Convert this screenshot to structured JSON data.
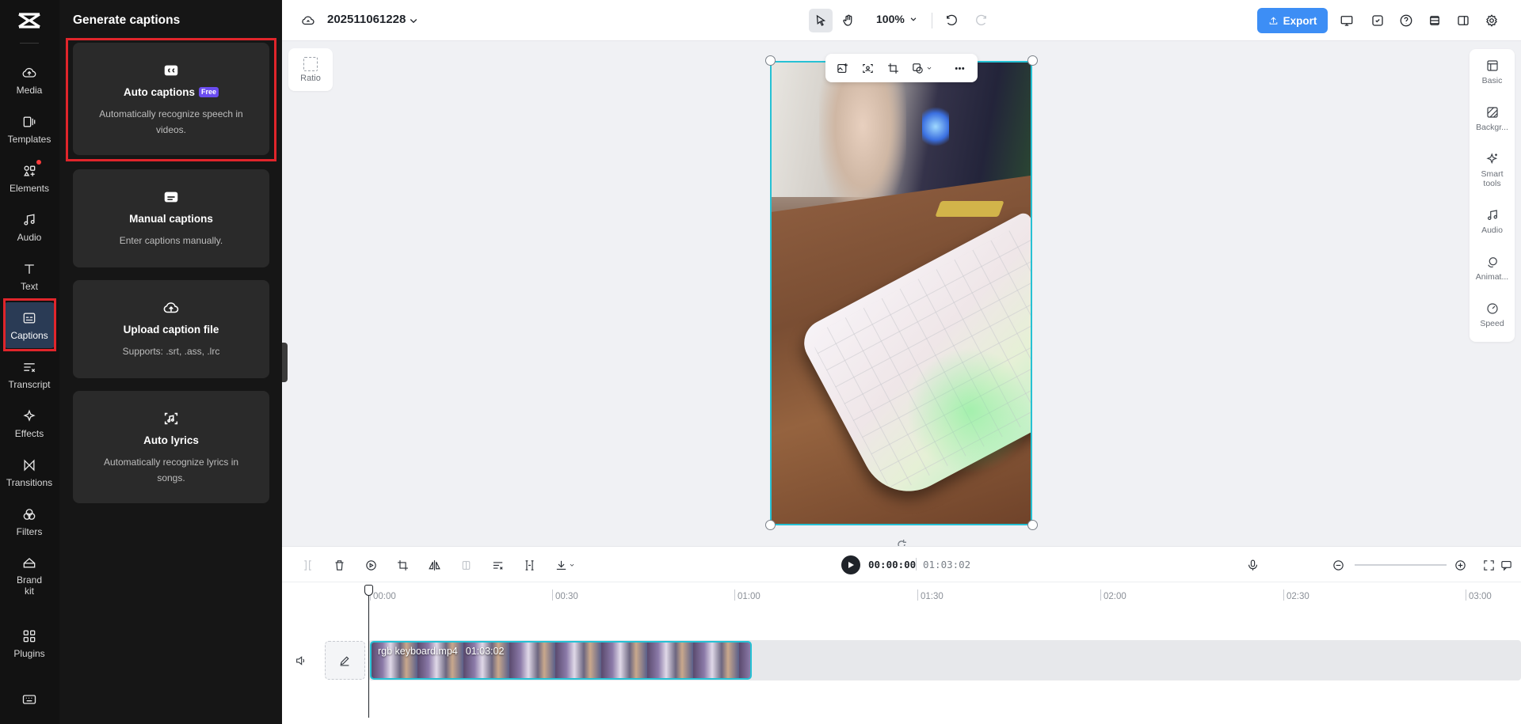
{
  "colors": {
    "accent": "#3d8ef5",
    "selection": "#26c1d4",
    "highlight": "#e0252b",
    "rail_bg": "#121212",
    "panel_bg": "#161616"
  },
  "rail": {
    "items": [
      {
        "label": "Media",
        "icon": "cloud-upload-icon"
      },
      {
        "label": "Templates",
        "icon": "templates-icon"
      },
      {
        "label": "Elements",
        "icon": "elements-icon"
      },
      {
        "label": "Audio",
        "icon": "music-note-icon"
      },
      {
        "label": "Text",
        "icon": "text-icon"
      },
      {
        "label": "Captions",
        "icon": "captions-icon",
        "active": true
      },
      {
        "label": "Transcript",
        "icon": "transcript-icon"
      },
      {
        "label": "Effects",
        "icon": "sparkle-icon"
      },
      {
        "label": "Transitions",
        "icon": "transitions-icon"
      },
      {
        "label": "Filters",
        "icon": "filters-icon"
      },
      {
        "label": "Brand\nkit",
        "icon": "brand-kit-icon"
      },
      {
        "label": "Plugins",
        "icon": "plugins-icon"
      }
    ]
  },
  "panel": {
    "title": "Generate captions",
    "cards": [
      {
        "title": "Auto captions",
        "badge": "Free",
        "desc": "Automatically recognize speech in videos.",
        "icon": "cc-icon"
      },
      {
        "title": "Manual captions",
        "desc": "Enter captions manually.",
        "icon": "subtitle-icon"
      },
      {
        "title": "Upload caption file",
        "desc": "Supports: .srt, .ass, .lrc",
        "icon": "cloud-upload-icon"
      },
      {
        "title": "Auto lyrics",
        "desc": "Automatically recognize lyrics in songs.",
        "icon": "lyrics-scan-icon"
      }
    ]
  },
  "topbar": {
    "project_name": "202511061228",
    "zoom": "100%",
    "export_label": "Export"
  },
  "canvas": {
    "ratio_label": "Ratio"
  },
  "props": {
    "items": [
      {
        "label": "Basic",
        "icon": "basic-icon"
      },
      {
        "label": "Backgr...",
        "icon": "background-icon"
      },
      {
        "label": "Smart tools",
        "icon": "smart-tools-icon"
      },
      {
        "label": "Audio",
        "icon": "music-note-icon"
      },
      {
        "label": "Animat...",
        "icon": "animation-icon"
      },
      {
        "label": "Speed",
        "icon": "speed-icon"
      }
    ]
  },
  "timeline": {
    "current_time": "00:00:00",
    "total_time": "01:03:02",
    "ruler": [
      "00:00",
      "00:30",
      "01:00",
      "01:30",
      "02:00",
      "02:30",
      "03:00"
    ],
    "clip": {
      "name": "rgb keyboard.mp4",
      "duration": "01:03:02"
    }
  }
}
